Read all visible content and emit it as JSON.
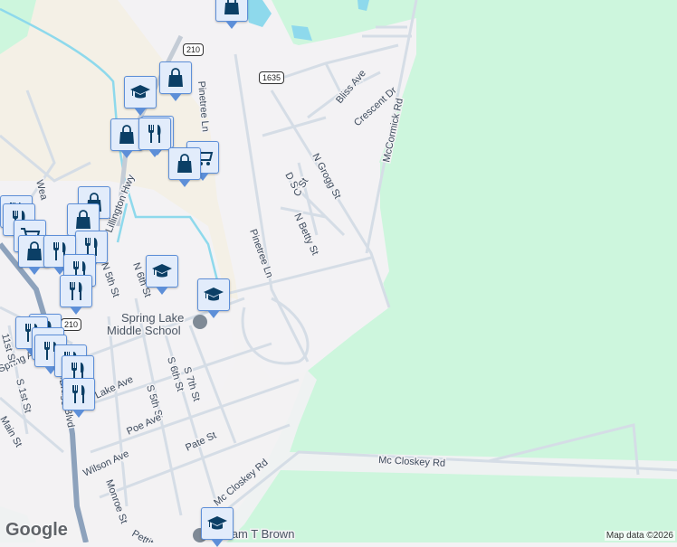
{
  "map": {
    "colors": {
      "land": "#f3f2f4",
      "park": "#cdf6dd",
      "developed": "#f4f0e6",
      "water": "#8ed9ec",
      "road": "#d5dde6",
      "highway": "#8da2bc",
      "marker_bg": "#e2ecfb",
      "marker_border": "#5d8fd8",
      "icon": "#0b3f66"
    },
    "shields": [
      "210",
      "1635",
      "210"
    ],
    "streets": [
      "Bliss Ave",
      "Crescent Dr",
      "McCormick Rd",
      "N Grogg St",
      "D St",
      "C St",
      "N Betty St",
      "Pinetree Ln",
      "Pinetree Ln",
      "Lillington Hwy",
      "N 5th St",
      "N 6th St",
      "S 5th St",
      "S 6th St",
      "S 7th St",
      "Lake Ave",
      "Poe Ave",
      "Pate St",
      "Wilson Ave",
      "Monroe St",
      "Mc Closkey Rd",
      "Mc Closkey Rd",
      "S Bragg Blvd",
      "S 1st St",
      "Main St",
      "Spring Ave",
      "11st St",
      "Wea",
      "Pettit"
    ],
    "places": {
      "school1_line1": "Spring Lake",
      "school1_line2": "Middle School",
      "school2": "William T Brown"
    },
    "markers": [
      "shopping",
      "education",
      "shopping",
      "shopping",
      "restaurant",
      "restaurant",
      "grocery",
      "shopping",
      "shopping",
      "shopping",
      "restaurant",
      "restaurant",
      "grocery",
      "shopping",
      "restaurant",
      "restaurant",
      "restaurant",
      "restaurant",
      "education",
      "education",
      "restaurant",
      "restaurant",
      "restaurant",
      "restaurant",
      "restaurant",
      "restaurant",
      "restaurant",
      "education"
    ],
    "logo": "Google",
    "attribution": "Map data ©2026"
  }
}
